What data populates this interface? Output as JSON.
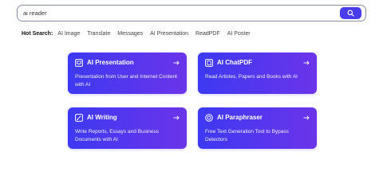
{
  "search": {
    "value": "ai reader",
    "button_icon": "search-icon",
    "button_color": "#4a3cf0"
  },
  "hot_search": {
    "label": "Hot Search:",
    "items": [
      "AI Image",
      "Translate",
      "Messages",
      "AI Presentation",
      "ReadPDF",
      "AI Poster"
    ]
  },
  "cards": [
    {
      "icon": "presentation-icon",
      "title": "AI Presentation",
      "description": "Presentation from User and Internet Content with AI"
    },
    {
      "icon": "chat-pdf-icon",
      "title": "AI ChatPDF",
      "description": "Read Articles, Papers and Books with AI"
    },
    {
      "icon": "writing-icon",
      "title": "AI Writing",
      "description": "Write Reports, Essays and Business Documents with AI"
    },
    {
      "icon": "paraphraser-icon",
      "title": "AI Paraphraser",
      "description": "Free Text Generation Tool to Bypass Detectors"
    }
  ],
  "colors": {
    "card_gradient_start": "#3d39f2",
    "card_gradient_end": "#6b34ea"
  }
}
